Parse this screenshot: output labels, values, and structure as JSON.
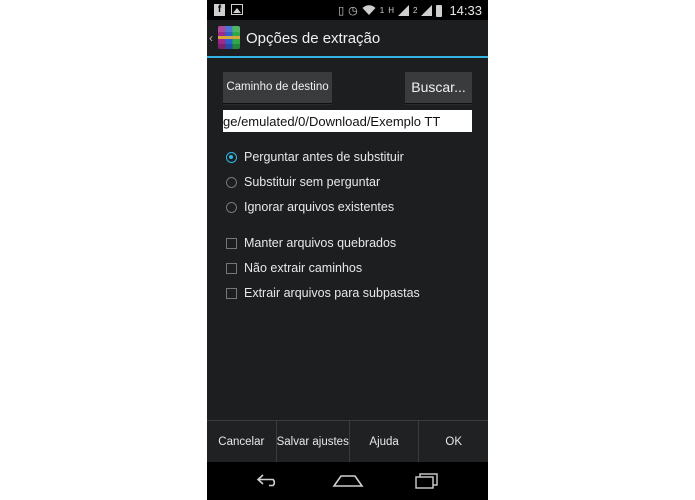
{
  "status_bar": {
    "notification_fb": "f",
    "network_label_1": "1",
    "network_label_h": "H",
    "network_label_2": "2",
    "time": "14:33"
  },
  "action_bar": {
    "up_glyph": "‹",
    "title": "Opções de extração",
    "accent_color": "#33b5e5"
  },
  "destination": {
    "path_button_label": "Caminho de destino",
    "browse_button_label": "Buscar...",
    "path_value": "ge/emulated/0/Download/Exemplo TT"
  },
  "overwrite_options": [
    {
      "label": "Perguntar antes de substituir",
      "selected": true
    },
    {
      "label": "Substituir sem perguntar",
      "selected": false
    },
    {
      "label": "Ignorar arquivos existentes",
      "selected": false
    }
  ],
  "extra_options": [
    {
      "label": "Manter arquivos quebrados",
      "checked": false
    },
    {
      "label": "Não extrair caminhos",
      "checked": false
    },
    {
      "label": "Extrair arquivos para subpastas",
      "checked": false
    }
  ],
  "bottom_buttons": {
    "cancel": "Cancelar",
    "save": "Salvar ajustes",
    "help": "Ajuda",
    "ok": "OK"
  },
  "icons": {
    "status": [
      "facebook-icon",
      "image-icon",
      "vibrate-icon",
      "alarm-icon",
      "wifi-icon",
      "signal-icon",
      "battery-icon"
    ],
    "nav": [
      "back-icon",
      "home-icon",
      "recent-apps-icon"
    ]
  }
}
